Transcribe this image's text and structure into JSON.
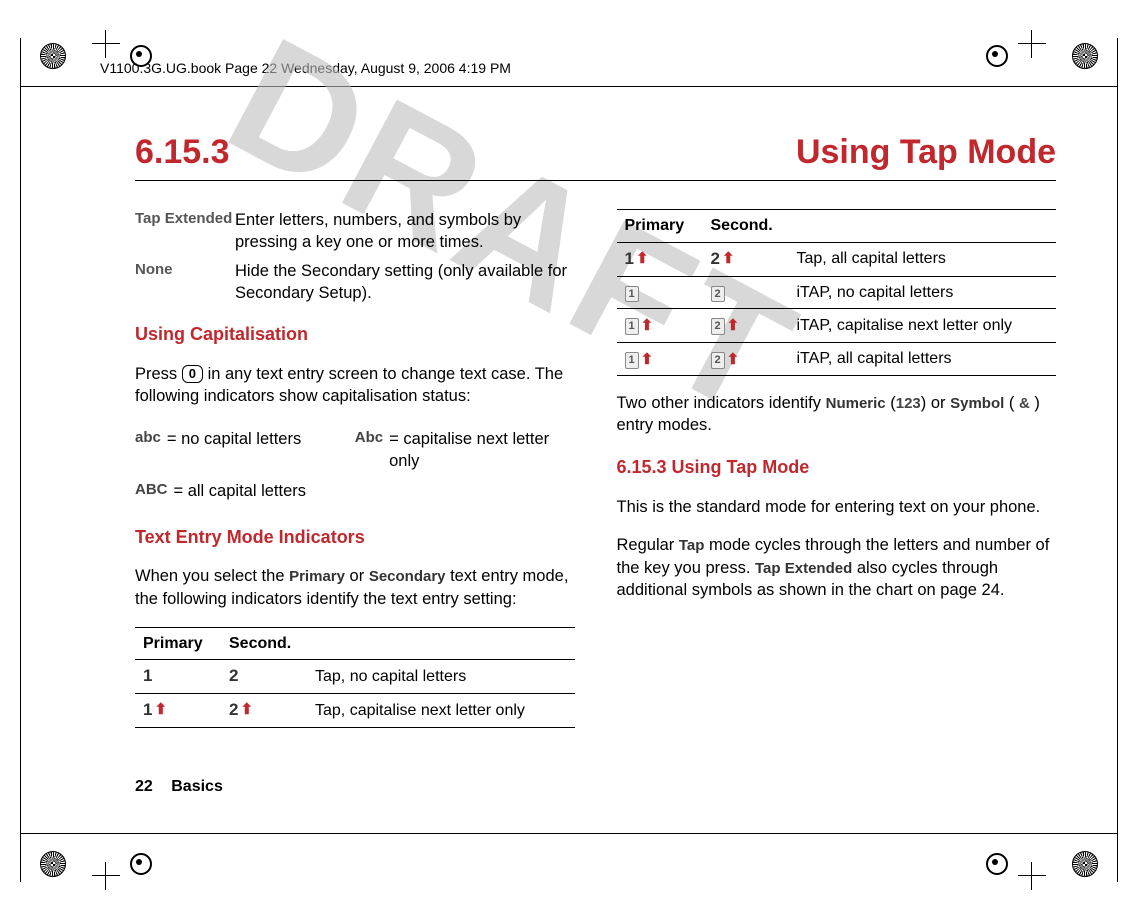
{
  "header_note": "V1100.3G.UG.book  Page 22  Wednesday, August 9, 2006  4:19 PM",
  "title": {
    "number": "6.15.3",
    "text": "Using Tap Mode"
  },
  "watermark": "DRAFT",
  "left": {
    "defs": [
      {
        "term": "Tap Extended",
        "body": "Enter letters, numbers, and symbols by pressing a key one or more times."
      },
      {
        "term": "None",
        "body": "Hide the Secondary setting (only available for Secondary Setup)."
      }
    ],
    "cap_heading": "Using Capitalisation",
    "cap_para_a": "Press ",
    "cap_key": "0",
    "cap_para_b": " in any text entry screen to change text case. The following indicators show capitalisation status:",
    "caps": [
      {
        "icon": "abc",
        "text": " = no capital letters"
      },
      {
        "icon": "Abc",
        "text": " = capitalise next letter only"
      },
      {
        "icon": "ABC",
        "text": " = all capital letters"
      }
    ],
    "ind_heading": "Text Entry Mode Indicators",
    "ind_para_a": "When you select the ",
    "ind_kw1": "Primary",
    "ind_mid": " or ",
    "ind_kw2": "Secondary",
    "ind_para_b": " text entry mode, the following indicators identify the text entry setting:",
    "tbl": {
      "h1": "Primary",
      "h2": "Second.",
      "rows": [
        {
          "p": "1",
          "s": "2",
          "pu": false,
          "su": false,
          "d": "Tap, no capital letters"
        },
        {
          "p": "1",
          "s": "2",
          "pu": true,
          "su": true,
          "d": "Tap, capitalise next letter only"
        }
      ]
    }
  },
  "right": {
    "tbl": {
      "h1": "Primary",
      "h2": "Second.",
      "rows": [
        {
          "chip": false,
          "p": "1",
          "s": "2",
          "pu": true,
          "su": true,
          "d": "Tap, all capital letters"
        },
        {
          "chip": true,
          "p": "1",
          "s": "2",
          "pu": false,
          "su": false,
          "d": "iTAP, no capital letters"
        },
        {
          "chip": true,
          "p": "1",
          "s": "2",
          "pu": true,
          "su": true,
          "d": "iTAP, capitalise next letter only"
        },
        {
          "chip": true,
          "p": "1",
          "s": "2",
          "pu": true,
          "su": true,
          "d": "iTAP, all capital letters"
        }
      ]
    },
    "after_a": "Two other indicators identify ",
    "kw_num": "Numeric",
    "num_icon": "123",
    "after_mid": " or ",
    "kw_sym": "Symbol",
    "sym_icon": "&",
    "after_b": " entry modes.",
    "h3": "6.15.3 Using Tap Mode",
    "p1": "This is the standard mode for entering text on your phone.",
    "p2a": "Regular ",
    "kw_tap": "Tap",
    "p2b": " mode cycles through the letters and number of the key you press. ",
    "kw_tapx": "Tap Extended",
    "p2c": " also cycles through additional symbols as shown in the chart on page 24."
  },
  "footer": {
    "page": "22",
    "section": "Basics"
  }
}
